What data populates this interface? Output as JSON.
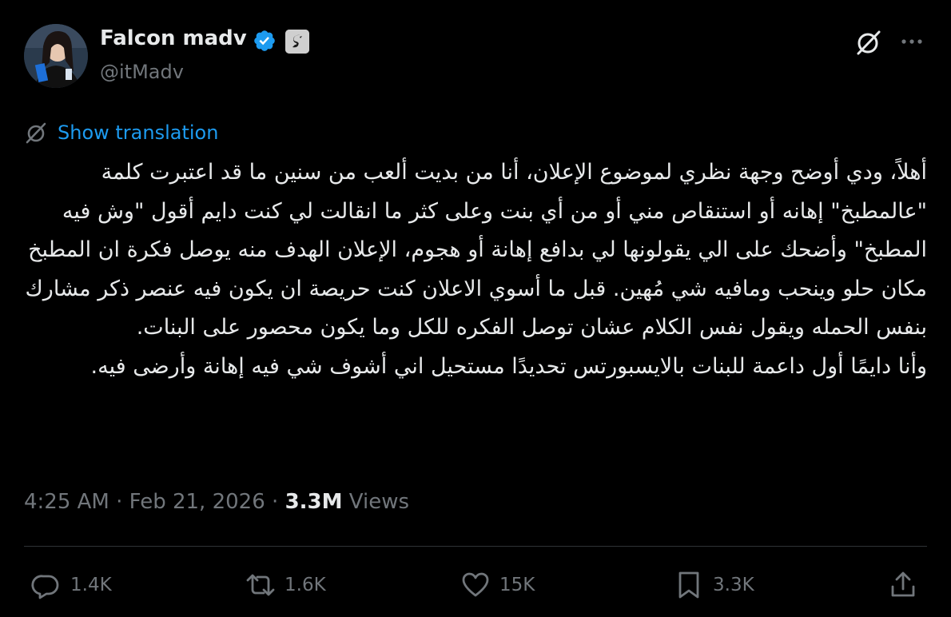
{
  "header": {
    "display_name": "Falcon madv",
    "handle": "@itMadv"
  },
  "translation": {
    "label": "Show translation"
  },
  "tweet": {
    "paragraph_1": "أهلاً، ودي أوضح وجهة نظري لموضوع الإعلان، أنا من بديت ألعب من سنين ما قد اعتبرت كلمة \"عالمطبخ\" إهانه أو استنقاص مني أو من أي بنت وعلى كثر ما انقالت لي كنت دايم أقول \"وش فيه المطبخ\" وأضحك على الي يقولونها لي بدافع إهانة أو هجوم، الإعلان الهدف منه يوصل فكرة ان المطبخ مكان حلو وينحب ومافيه شي مُهين. قبل ما أسوي الاعلان كنت حريصة ان يكون فيه عنصر ذكر مشارك بنفس الحمله ويقول نفس الكلام عشان توصل الفكره للكل وما يكون محصور على البنات.",
    "paragraph_2": "وأنا دايمًا أول داعمة للبنات بالايسبورتس تحديدًا مستحيل اني أشوف شي فيه إهانة وأرضى فيه."
  },
  "meta": {
    "time": "4:25 AM",
    "separator_1": " · ",
    "date": "Feb 21, 2026",
    "separator_2": " · ",
    "views_count": "3.3M",
    "views_label": " Views"
  },
  "actions": {
    "replies": "1.4K",
    "reposts": "1.6K",
    "likes": "15K",
    "bookmarks": "3.3K"
  },
  "colors": {
    "background": "#000000",
    "text": "#e7e9ea",
    "secondary": "#71767b",
    "accent": "#1d9bf0",
    "divider": "#2f3336"
  },
  "icons": {
    "verified": "verified-badge-icon",
    "affiliate": "affiliate-badge-icon",
    "grok": "grok-icon",
    "more": "more-horizontal-icon",
    "translate": "translate-icon",
    "reply": "reply-icon",
    "repost": "repost-icon",
    "like": "heart-icon",
    "bookmark": "bookmark-icon",
    "share": "share-icon"
  }
}
